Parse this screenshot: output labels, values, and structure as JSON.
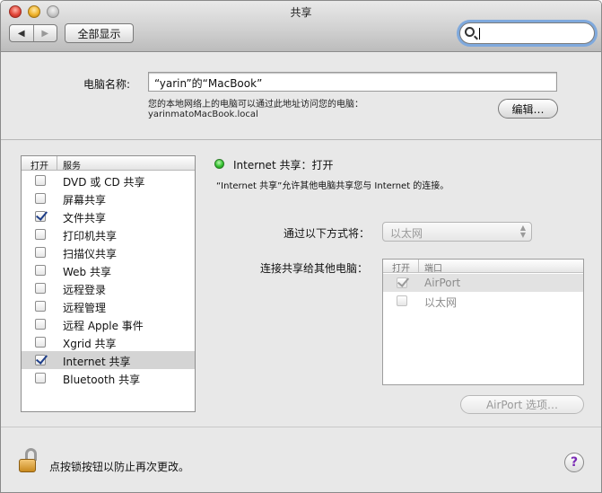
{
  "window": {
    "title": "共享"
  },
  "toolbar": {
    "back_glyph": "◀",
    "forward_glyph": "▶",
    "show_all_label": "全部显示",
    "search_value": ""
  },
  "computer": {
    "name_label": "电脑名称:",
    "name_value": "“yarin”的“MacBook”",
    "hint_line1": "您的本地网络上的电脑可以通过此地址访问您的电脑：",
    "hint_line2": "yarinmatoMacBook.local",
    "edit_label": "编辑…"
  },
  "services": {
    "header_on": "打开",
    "header_service": "服务",
    "items": [
      {
        "label": "DVD 或 CD 共享",
        "checked": false,
        "selected": false
      },
      {
        "label": "屏幕共享",
        "checked": false,
        "selected": false
      },
      {
        "label": "文件共享",
        "checked": true,
        "selected": false
      },
      {
        "label": "打印机共享",
        "checked": false,
        "selected": false
      },
      {
        "label": "扫描仪共享",
        "checked": false,
        "selected": false
      },
      {
        "label": "Web 共享",
        "checked": false,
        "selected": false
      },
      {
        "label": "远程登录",
        "checked": false,
        "selected": false
      },
      {
        "label": "远程管理",
        "checked": false,
        "selected": false
      },
      {
        "label": "远程 Apple 事件",
        "checked": false,
        "selected": false
      },
      {
        "label": "Xgrid 共享",
        "checked": false,
        "selected": false
      },
      {
        "label": "Internet 共享",
        "checked": true,
        "selected": true
      },
      {
        "label": "Bluetooth 共享",
        "checked": false,
        "selected": false
      }
    ]
  },
  "detail": {
    "status_text": "Internet 共享：打开",
    "status_color": "#33c22f",
    "description": "“Internet 共享”允许其他电脑共享您与 Internet 的连接。",
    "via_label": "通过以下方式将：",
    "via_value": "以太网",
    "share_to_label": "连接共享给其他电脑：",
    "ports_header_on": "打开",
    "ports_header_port": "端口",
    "ports": [
      {
        "label": "AirPort",
        "checked": true,
        "selected": true
      },
      {
        "label": "以太网",
        "checked": false,
        "selected": false
      }
    ],
    "airport_options_label": "AirPort 选项…"
  },
  "footer": {
    "lock_text": "点按锁按钮以防止再次更改。",
    "help_label": "?"
  }
}
